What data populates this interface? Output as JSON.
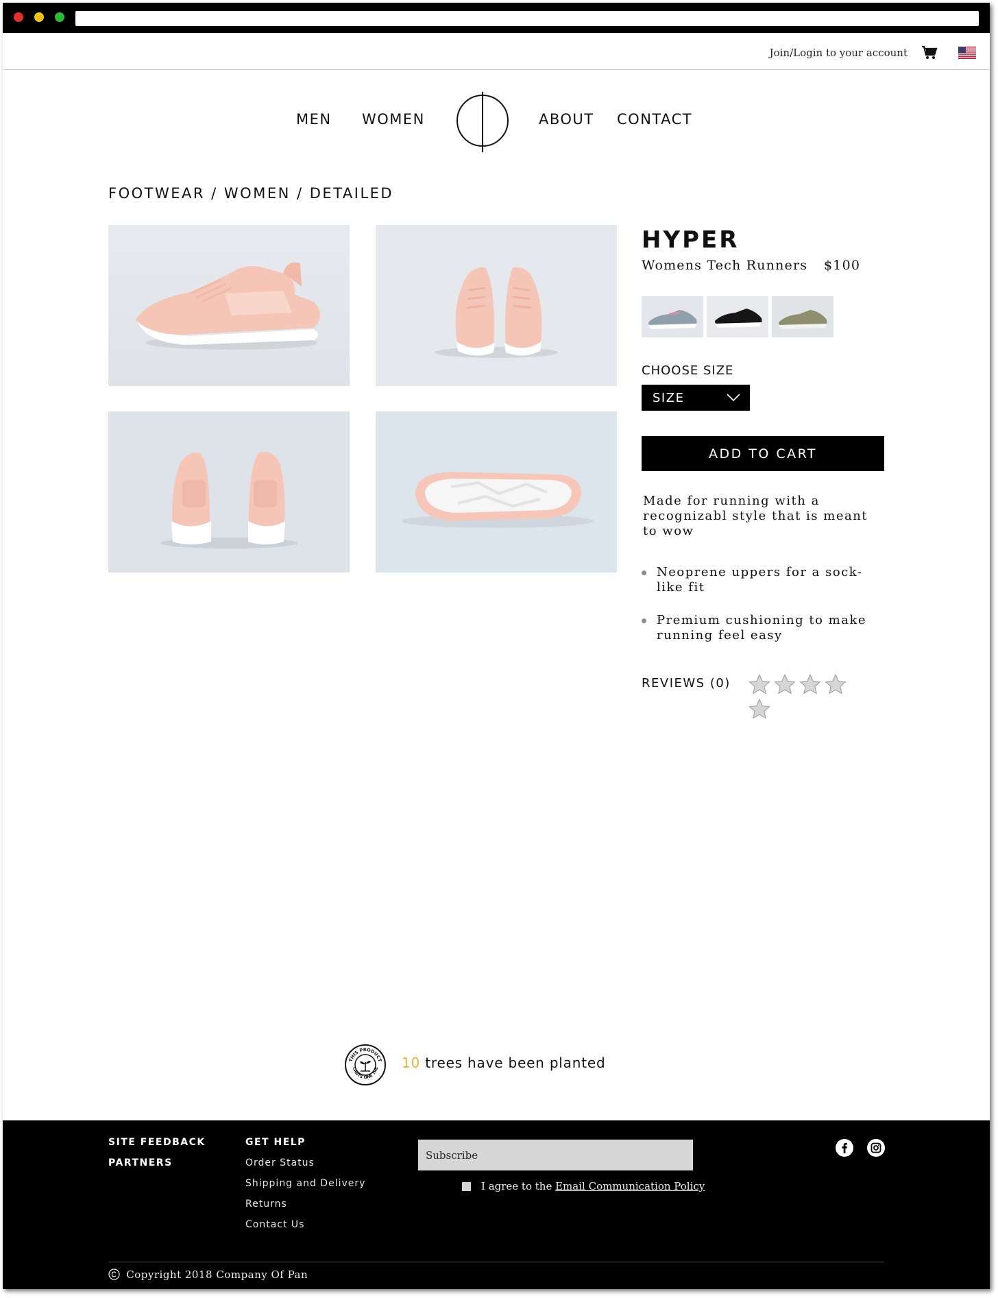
{
  "header": {
    "login_text": "Join/Login to your account",
    "cart_icon": "cart-icon",
    "flag_icon": "us-flag-icon"
  },
  "nav": {
    "items": [
      {
        "label": "MEN"
      },
      {
        "label": "WOMEN"
      },
      {
        "label": "ABOUT"
      },
      {
        "label": "CONTACT"
      }
    ],
    "logo_icon": "brand-logo-icon"
  },
  "breadcrumb": {
    "items": [
      "FOOTWEAR",
      "WOMEN",
      "DETAILED"
    ],
    "separator": "/"
  },
  "product": {
    "name": "HYPER",
    "subtitle": "Womens Tech Runners",
    "price": "$100",
    "color_swatches": [
      "grey-pink",
      "black",
      "olive"
    ],
    "choose_size_label": "CHOOSE SIZE",
    "size_select_label": "SIZE",
    "add_to_cart_label": "ADD TO CART",
    "description": "Made for running with a recognizabl style that is meant to wow",
    "features": [
      "Neoprene uppers for a sock-like fit",
      "Premium cushioning to make running feel easy"
    ],
    "reviews_label": "REVIEWS (0)",
    "rating": 0,
    "rating_max": 5
  },
  "trees": {
    "count": "10",
    "text": "trees have been planted",
    "badge_top_text": "THIS PRODUCT",
    "badge_bottom_text": "PLANTS ONE TREE"
  },
  "footer": {
    "col1": [
      "SITE FEEDBACK",
      "PARTNERS"
    ],
    "col2_heading": "GET HELP",
    "col2_links": [
      "Order Status",
      "Shipping and Delivery",
      "Returns",
      "Contact Us"
    ],
    "subscribe_placeholder": "Subscribe",
    "agree_prefix": "I agree to the",
    "agree_link": "Email Communication Policy",
    "social_icons": [
      "facebook-icon",
      "instagram-icon"
    ],
    "copyright": "Copyright 2018 Company Of Pan"
  },
  "colors": {
    "accent_yellow": "#e5b52a",
    "footer_bg": "#000000",
    "product_bg": "#e3e7ec",
    "shoe_pink": "#f4c5b5"
  }
}
